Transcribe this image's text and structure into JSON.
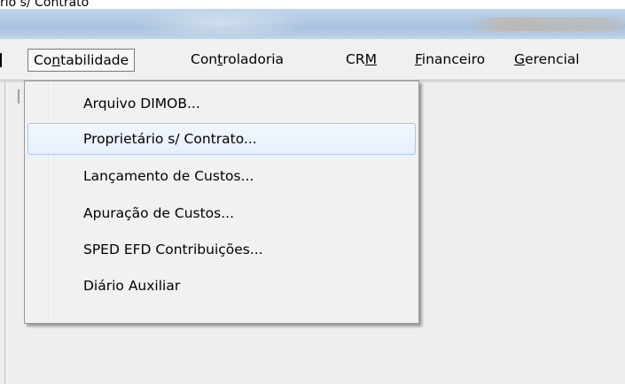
{
  "caption": "rio s/ Contrato",
  "menubar": {
    "left_stub": "",
    "items": [
      {
        "label": "Contabilidade",
        "active": true
      },
      {
        "label": "Controladoria",
        "active": false
      },
      {
        "label": "CRM",
        "active": false
      },
      {
        "label": "Financeiro",
        "active": false
      },
      {
        "label": "Gerencial",
        "active": false
      }
    ]
  },
  "dropdown": {
    "items": [
      {
        "label": "Arquivo DIMOB...",
        "highlighted": false
      },
      {
        "label": "Proprietário s/ Contrato...",
        "highlighted": true
      },
      {
        "label": "Lançamento de Custos...",
        "highlighted": false
      },
      {
        "label": "Apuração de Custos...",
        "highlighted": false
      },
      {
        "label": "SPED EFD Contribuições...",
        "highlighted": false
      },
      {
        "label": "Diário Auxiliar",
        "highlighted": false
      }
    ]
  }
}
